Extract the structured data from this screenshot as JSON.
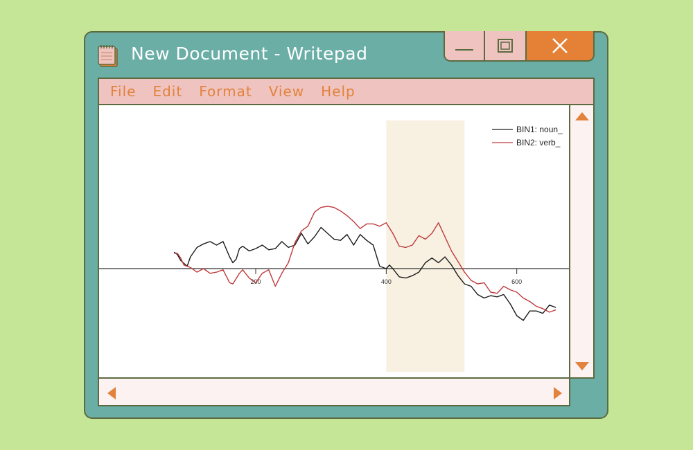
{
  "window": {
    "title": "New Document - Writepad",
    "icon": "notepad-icon",
    "controls": [
      "minimize-icon",
      "maximize-icon",
      "close-icon"
    ]
  },
  "menu": {
    "items": [
      {
        "label": "File"
      },
      {
        "label": "Edit"
      },
      {
        "label": "Format"
      },
      {
        "label": "View"
      },
      {
        "label": "Help"
      }
    ]
  },
  "colors": {
    "background": "#c5e697",
    "window": "#6aaea6",
    "menubar": "#efc3bf",
    "menu_text": "#e2823c",
    "close_button": "#e58136",
    "scrollbar": "#fbf2f1"
  },
  "chart_data": {
    "type": "line",
    "title": "",
    "xlabel": "",
    "ylabel": "",
    "xlim": [
      -40,
      680
    ],
    "ylim": [
      -5,
      5
    ],
    "x_ticks": [
      200,
      400,
      600
    ],
    "highlight_window": [
      400,
      520
    ],
    "legend_position": "top-right",
    "series": [
      {
        "name": "BIN1: noun_",
        "color": "#1a1a1a",
        "x": [
          75,
          80,
          85,
          95,
          100,
          110,
          120,
          130,
          140,
          150,
          160,
          165,
          170,
          175,
          180,
          190,
          200,
          210,
          220,
          230,
          240,
          250,
          260,
          270,
          280,
          290,
          300,
          310,
          320,
          330,
          340,
          350,
          360,
          370,
          380,
          390,
          400,
          405,
          410,
          420,
          430,
          440,
          450,
          460,
          470,
          480,
          490,
          500,
          510,
          520,
          530,
          540,
          550,
          560,
          570,
          580,
          590,
          600,
          610,
          620,
          630,
          640,
          650,
          660
        ],
        "y": [
          1.4,
          1.2,
          0.7,
          0.2,
          1.0,
          1.8,
          2.1,
          2.3,
          2.0,
          2.3,
          1.0,
          0.5,
          0.8,
          1.7,
          1.9,
          1.5,
          1.7,
          2.0,
          1.6,
          1.7,
          2.3,
          1.8,
          2.0,
          3.0,
          2.1,
          2.7,
          3.5,
          3.0,
          2.5,
          2.4,
          2.9,
          2.0,
          2.9,
          2.4,
          2.0,
          0.2,
          0.0,
          0.3,
          0.0,
          -0.7,
          -0.8,
          -0.6,
          -0.3,
          0.5,
          0.9,
          0.5,
          1.0,
          0.3,
          -0.6,
          -1.3,
          -1.5,
          -2.2,
          -2.5,
          -2.3,
          -2.4,
          -2.2,
          -3.0,
          -4.0,
          -4.4,
          -3.6,
          -3.6,
          -3.8,
          -3.1,
          -3.3
        ]
      },
      {
        "name": "BIN2: verb_",
        "color": "#c0393b",
        "x": [
          75,
          80,
          85,
          90,
          100,
          110,
          120,
          130,
          140,
          150,
          160,
          165,
          175,
          180,
          190,
          200,
          210,
          220,
          230,
          240,
          250,
          260,
          270,
          280,
          290,
          300,
          310,
          320,
          330,
          340,
          350,
          360,
          370,
          380,
          390,
          400,
          410,
          420,
          430,
          440,
          450,
          460,
          470,
          480,
          490,
          500,
          510,
          520,
          530,
          540,
          550,
          560,
          570,
          580,
          590,
          600,
          610,
          620,
          630,
          640,
          650,
          660
        ],
        "y": [
          1.3,
          1.3,
          0.9,
          0.3,
          0.1,
          -0.3,
          0.0,
          -0.4,
          -0.3,
          -0.1,
          -1.2,
          -1.3,
          -0.4,
          -0.1,
          -0.8,
          -1.2,
          -0.4,
          -0.1,
          -1.5,
          -0.4,
          0.5,
          2.2,
          3.2,
          3.6,
          4.8,
          5.2,
          5.3,
          5.2,
          4.9,
          4.5,
          4.0,
          3.4,
          3.8,
          3.8,
          3.6,
          3.9,
          3.0,
          1.9,
          1.8,
          2.0,
          2.8,
          2.5,
          3.0,
          3.9,
          2.7,
          1.5,
          0.6,
          -0.3,
          -1.0,
          -1.3,
          -1.2,
          -2.0,
          -2.1,
          -1.5,
          -1.8,
          -2.0,
          -2.5,
          -2.8,
          -3.2,
          -3.4,
          -3.7,
          -3.5
        ]
      }
    ]
  }
}
